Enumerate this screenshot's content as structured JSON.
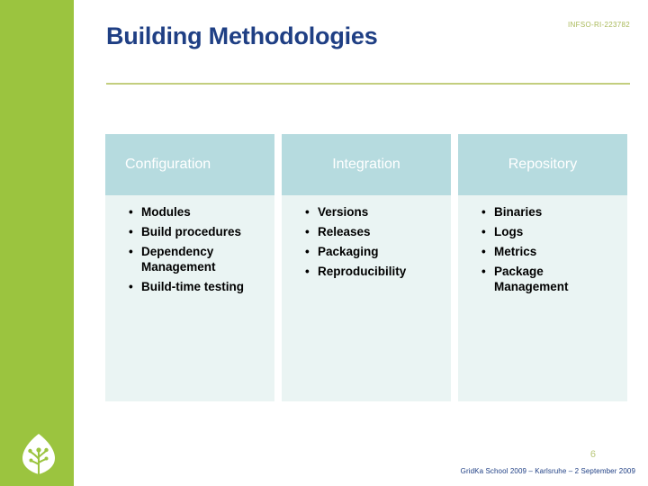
{
  "slide": {
    "title": "Building Methodologies",
    "project_code": "INFSO-RI-223782",
    "page_number": "6",
    "footer": "GridKa School 2009 – Karlsruhe – 2 September 2009",
    "logo_name": "leaf-logo"
  },
  "colors": {
    "sidebar_green": "#9bc43f",
    "title_blue": "#1f3f84",
    "rule_olive": "#c3ce7e",
    "header_teal": "#b6dbdf",
    "body_teal": "#eaf4f3",
    "code_olive": "#a9b959",
    "page_number_olive": "#b9c77a"
  },
  "table": {
    "columns": [
      {
        "header": "Configuration",
        "items": [
          "Modules",
          "Build procedures",
          "Dependency Management",
          "Build-time testing"
        ]
      },
      {
        "header": "Integration",
        "items": [
          "Versions",
          "Releases",
          "Packaging",
          "Reproducibility"
        ]
      },
      {
        "header": "Repository",
        "items": [
          "Binaries",
          "Logs",
          "Metrics",
          "Package Management"
        ]
      }
    ]
  }
}
